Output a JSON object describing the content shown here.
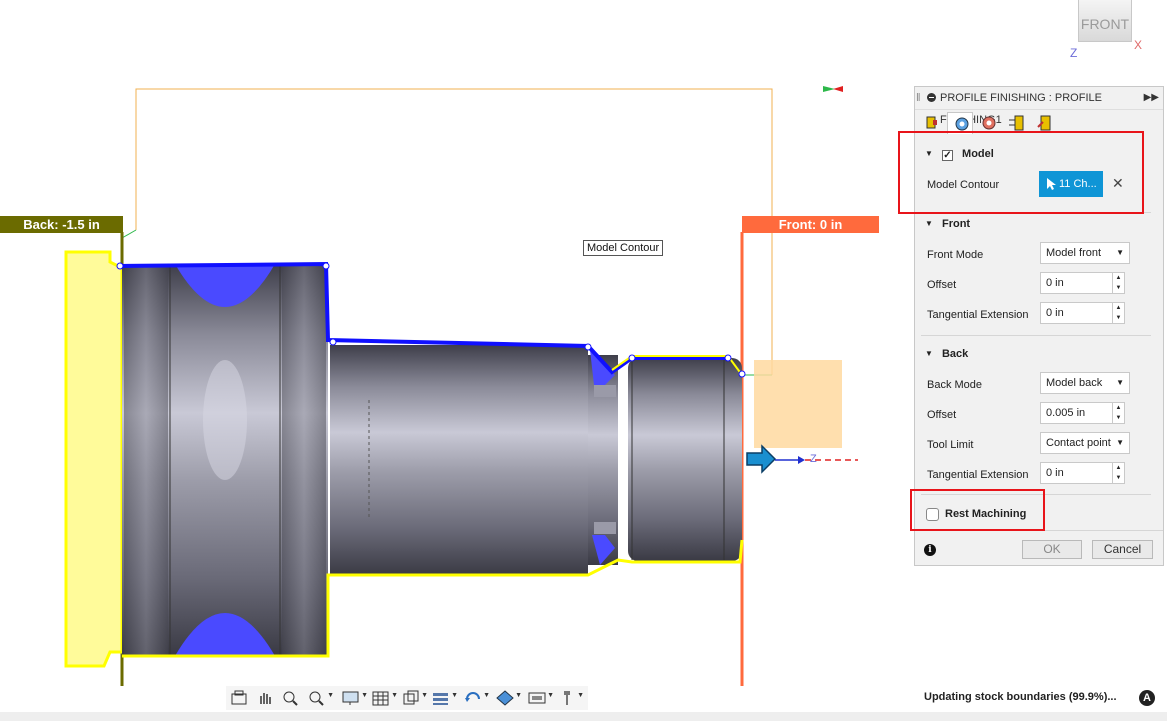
{
  "viewcube": {
    "face_label": "FRONT",
    "axis_x": "X",
    "axis_z": "Z"
  },
  "viewport": {
    "back_label": "Back: -1.5 in",
    "front_label": "Front: 0 in",
    "tooltip": "Model Contour",
    "axis_z": "Z",
    "colors": {
      "selection": "#1010ff",
      "stock": "#ffff00",
      "back_plane": "#6b6b00",
      "front_plane": "#ff6a3d",
      "part": "#5a5a66"
    }
  },
  "panel": {
    "title": "PROFILE FINISHING : PROFILE FINISHING1",
    "tabs": [
      "tool-tab",
      "geometry-tab",
      "heights-tab",
      "passes-tab",
      "linking-tab"
    ],
    "model": {
      "heading": "Model",
      "checked": true,
      "contour_label": "Model Contour",
      "selection_button": "11 Ch..."
    },
    "front": {
      "heading": "Front",
      "mode_label": "Front Mode",
      "mode_value": "Model front",
      "offset_label": "Offset",
      "offset_value": "0 in",
      "tangential_label": "Tangential Extension",
      "tangential_value": "0 in"
    },
    "back": {
      "heading": "Back",
      "mode_label": "Back Mode",
      "mode_value": "Model back",
      "offset_label": "Offset",
      "offset_value": "0.005 in",
      "tool_limit_label": "Tool Limit",
      "tool_limit_value": "Contact point",
      "tangential_label": "Tangential Extension",
      "tangential_value": "0 in"
    },
    "rest_machining": {
      "label": "Rest Machining",
      "checked": false
    },
    "ok_label": "OK",
    "cancel_label": "Cancel"
  },
  "status": {
    "text": "Updating stock boundaries (99.9%)...",
    "icon": "A"
  },
  "toolbar": {
    "items": [
      "capture-icon",
      "pan-icon",
      "zoom-window-icon",
      "zoom-icon",
      "display-icon",
      "grid-icon",
      "view-icon",
      "layers-icon",
      "orbit-icon",
      "appearance-icon",
      "environment-icon",
      "settings-icon"
    ]
  }
}
